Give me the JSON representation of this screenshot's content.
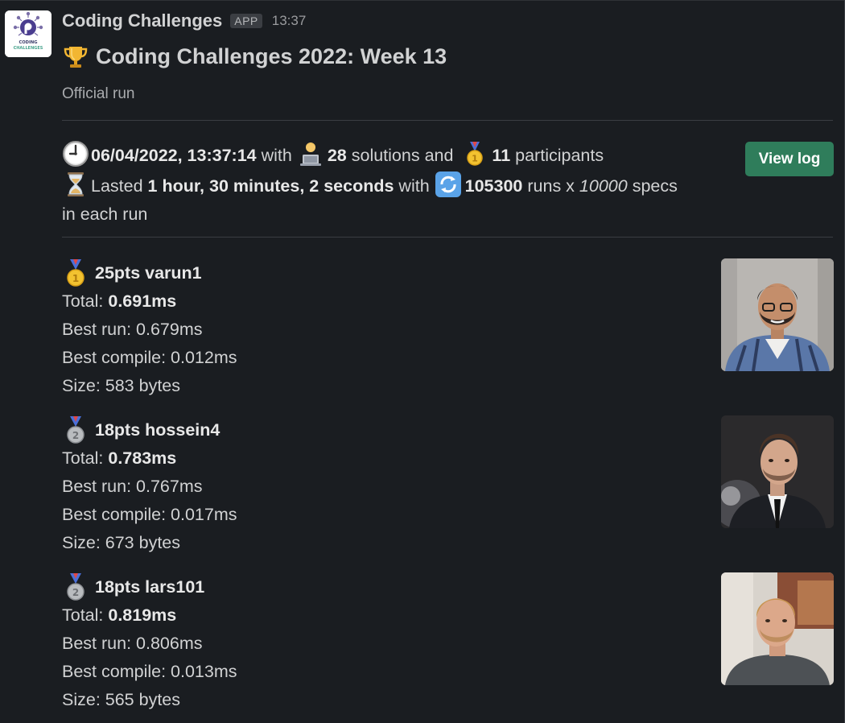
{
  "app": {
    "name": "Coding Challenges",
    "badge": "APP",
    "time": "13:37",
    "icon_text_top": "CODING",
    "icon_text_bottom": "CHALLENGES"
  },
  "post": {
    "title": "Coding Challenges 2022: Week 13",
    "subtitle": "Official run",
    "summary": {
      "datetime": "06/04/2022, 13:37:14",
      "with_1": "with",
      "solutions_count": "28",
      "solutions_and": "solutions and",
      "participants_count": "11",
      "participants_label": "participants",
      "lasted": "Lasted",
      "duration": "1 hour, 30 minutes, 2 seconds",
      "with_2": "with",
      "runs": "105300",
      "runs_x": "runs x",
      "specs": "10000",
      "specs_tail": "specs",
      "specs_tail2": "in each run"
    },
    "view_log_label": "View log"
  },
  "results": [
    {
      "medal": "gold-medal-icon",
      "name": "25pts varun1",
      "total_label": "Total:",
      "total": "0.691ms",
      "best_run": "Best run: 0.679ms",
      "best_compile": "Best compile: 0.012ms",
      "size": "Size: 583 bytes"
    },
    {
      "medal": "silver-medal-icon",
      "name": "18pts hossein4",
      "total_label": "Total:",
      "total": "0.783ms",
      "best_run": "Best run: 0.767ms",
      "best_compile": "Best compile: 0.017ms",
      "size": "Size: 673 bytes"
    },
    {
      "medal": "silver-medal-icon",
      "name": "18pts lars101",
      "total_label": "Total:",
      "total": "0.819ms",
      "best_run": "Best run: 0.806ms",
      "best_compile": "Best compile: 0.013ms",
      "size": "Size: 565 bytes"
    }
  ],
  "colors": {
    "background": "#1a1d21",
    "text": "#d1d2d3",
    "button": "#2f7d5b",
    "gold": "#f2c230",
    "silver": "#b9bcbf"
  }
}
